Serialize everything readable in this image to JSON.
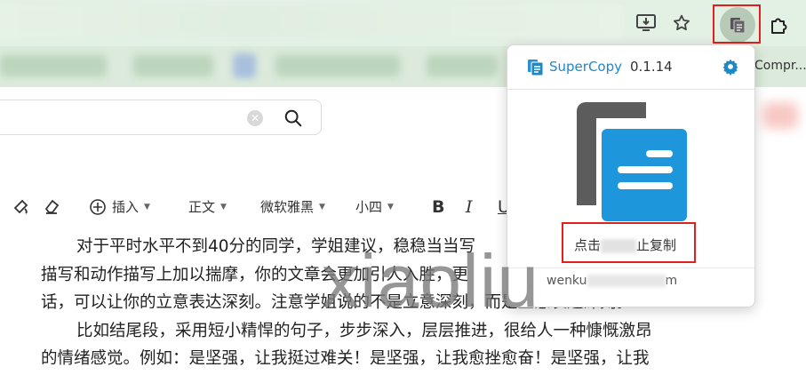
{
  "browser": {
    "bookmark_label": "Compr...",
    "icons": [
      "install-app-icon",
      "star-icon",
      "supercopy-extension-icon",
      "extensions-puzzle-icon"
    ]
  },
  "search": {
    "value": "",
    "icons": [
      "clear-icon",
      "search-icon"
    ]
  },
  "toolbar": {
    "insert_label": "插入",
    "style_label": "正文",
    "font_label": "微软雅黑",
    "size_label": "小四",
    "bold_label": "B",
    "italic_label": "I",
    "underline_label": "U"
  },
  "article": {
    "lines": [
      "对于平时水平不到40分的同学，学姐建议，稳稳当当写",
      "描写和动作描写上加以揣摩，你的文章会更加引人入胜，更",
      "话，可以让你的立意表达深刻。注意学姐说的不是立意深刻，而是立意表达深刻。",
      "比如结尾段，采用短小精悍的句子，步步深入，层层推进，很给人一种慷慨激昂",
      "的情绪感觉。例如：是坚强，让我挺过难关！是坚强，让我愈挫愈奋！是坚强，让我"
    ]
  },
  "watermark": "xiaoliu",
  "popup": {
    "title": "SuperCopy",
    "version": "0.1.14",
    "toggle_prefix": "点击",
    "toggle_suffix": "止复制",
    "footer_prefix": "wenku",
    "footer_suffix": "m",
    "accent_color": "#1e88c7",
    "highlight_color": "#e0201c"
  }
}
